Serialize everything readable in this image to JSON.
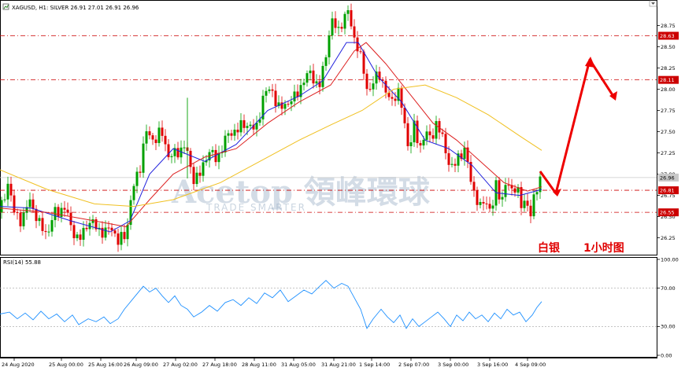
{
  "header": {
    "symbol_line": "XAGUSD, H1:  SILVER  26.91 27.01 26.91 26.96",
    "rsi_label": "RSI(14) 55.88"
  },
  "watermark": {
    "brand": "Acetop 領峰環球",
    "tagline": "TRADE SMARTER"
  },
  "annotation": {
    "asset": "白银",
    "timeframe": "1小时图"
  },
  "colors": {
    "bull": "#00a000",
    "bear": "#e00000",
    "ma_fast": "#2222dd",
    "ma_mid": "#dd2222",
    "ma_slow": "#f0c020",
    "level_line": "#cc0000",
    "rsi_line": "#1e90ff",
    "arrow": "#ee0000"
  },
  "chart_data": [
    {
      "type": "line",
      "title": "XAGUSD, H1:  SILVER  26.91 27.01 26.91 26.96",
      "x_tick_labels": [
        "24 Aug 2020",
        "25 Aug 00:00",
        "25 Aug 16:00",
        "26 Aug 09:00",
        "27 Aug 02:00",
        "27 Aug 18:00",
        "28 Aug 11:00",
        "31 Aug 05:00",
        "31 Aug 21:00",
        "1 Sep 14:00",
        "2 Sep 07:00",
        "3 Sep 00:00",
        "3 Sep 16:00",
        "4 Sep 09:00"
      ],
      "y_tick_labels": [
        "26.25",
        "26.50",
        "26.75",
        "27.00",
        "27.25",
        "27.50",
        "27.75",
        "28.00",
        "28.25",
        "28.50",
        "28.75"
      ],
      "ylim": [
        26.07,
        28.94
      ],
      "price_points": [
        [
          0,
          26.55
        ],
        [
          10,
          26.9
        ],
        [
          18,
          26.55
        ],
        [
          28,
          26.45
        ],
        [
          38,
          26.7
        ],
        [
          50,
          26.4
        ],
        [
          60,
          26.3
        ],
        [
          70,
          26.55
        ],
        [
          82,
          26.6
        ],
        [
          92,
          26.35
        ],
        [
          100,
          26.2
        ],
        [
          112,
          26.45
        ],
        [
          122,
          26.38
        ],
        [
          132,
          26.3
        ],
        [
          142,
          26.38
        ],
        [
          150,
          26.2
        ],
        [
          160,
          26.3
        ],
        [
          168,
          26.8
        ],
        [
          178,
          27.1
        ],
        [
          185,
          27.5
        ],
        [
          195,
          27.4
        ],
        [
          205,
          27.5
        ],
        [
          215,
          27.2
        ],
        [
          225,
          27.25
        ],
        [
          235,
          27.35
        ],
        [
          245,
          26.95
        ],
        [
          255,
          27.0
        ],
        [
          265,
          27.3
        ],
        [
          275,
          27.15
        ],
        [
          285,
          27.4
        ],
        [
          295,
          27.5
        ],
        [
          305,
          27.55
        ],
        [
          315,
          27.6
        ],
        [
          325,
          27.5
        ],
        [
          335,
          27.95
        ],
        [
          345,
          28.0
        ],
        [
          355,
          27.75
        ],
        [
          365,
          27.85
        ],
        [
          375,
          27.9
        ],
        [
          385,
          28.1
        ],
        [
          395,
          28.2
        ],
        [
          405,
          28.0
        ],
        [
          413,
          28.35
        ],
        [
          420,
          28.8
        ],
        [
          430,
          28.7
        ],
        [
          437,
          28.85
        ],
        [
          443,
          28.9
        ],
        [
          450,
          28.6
        ],
        [
          456,
          28.45
        ],
        [
          462,
          28.2
        ],
        [
          468,
          27.95
        ],
        [
          475,
          28.1
        ],
        [
          483,
          28.2
        ],
        [
          490,
          27.95
        ],
        [
          497,
          27.85
        ],
        [
          505,
          28.0
        ],
        [
          512,
          27.7
        ],
        [
          519,
          27.3
        ],
        [
          526,
          27.55
        ],
        [
          533,
          27.3
        ],
        [
          540,
          27.5
        ],
        [
          547,
          27.4
        ],
        [
          554,
          27.6
        ],
        [
          561,
          27.45
        ],
        [
          568,
          27.2
        ],
        [
          575,
          27.05
        ],
        [
          582,
          27.2
        ],
        [
          590,
          27.3
        ],
        [
          596,
          27.0
        ],
        [
          602,
          26.8
        ],
        [
          610,
          26.6
        ],
        [
          617,
          26.7
        ],
        [
          624,
          26.55
        ],
        [
          630,
          26.85
        ],
        [
          637,
          26.7
        ],
        [
          643,
          26.9
        ],
        [
          650,
          26.8
        ],
        [
          656,
          26.9
        ],
        [
          662,
          26.6
        ],
        [
          668,
          26.7
        ],
        [
          674,
          26.55
        ],
        [
          680,
          26.75
        ],
        [
          686,
          26.96
        ]
      ],
      "series": [
        {
          "values": [
            [
              0,
              26.62
            ],
            [
              40,
              26.6
            ],
            [
              90,
              26.45
            ],
            [
              140,
              26.32
            ],
            [
              165,
              26.45
            ],
            [
              190,
              27.0
            ],
            [
              220,
              27.3
            ],
            [
              260,
              27.15
            ],
            [
              300,
              27.35
            ],
            [
              340,
              27.75
            ],
            [
              380,
              27.92
            ],
            [
              410,
              28.1
            ],
            [
              440,
              28.55
            ],
            [
              455,
              28.55
            ],
            [
              480,
              28.15
            ],
            [
              510,
              27.85
            ],
            [
              540,
              27.4
            ],
            [
              570,
              27.3
            ],
            [
              600,
              27.1
            ],
            [
              630,
              26.78
            ],
            [
              660,
              26.75
            ],
            [
              688,
              26.82
            ]
          ]
        },
        {
          "values": [
            [
              0,
              26.6
            ],
            [
              60,
              26.55
            ],
            [
              120,
              26.45
            ],
            [
              160,
              26.38
            ],
            [
              190,
              26.7
            ],
            [
              220,
              27.0
            ],
            [
              260,
              27.2
            ],
            [
              300,
              27.3
            ],
            [
              340,
              27.6
            ],
            [
              380,
              27.85
            ],
            [
              420,
              28.05
            ],
            [
              450,
              28.45
            ],
            [
              465,
              28.55
            ],
            [
              490,
              28.3
            ],
            [
              520,
              27.95
            ],
            [
              550,
              27.6
            ],
            [
              580,
              27.4
            ],
            [
              610,
              27.15
            ],
            [
              640,
              26.9
            ],
            [
              670,
              26.8
            ],
            [
              688,
              26.85
            ]
          ]
        },
        {
          "values": [
            [
              0,
              27.05
            ],
            [
              60,
              26.82
            ],
            [
              120,
              26.65
            ],
            [
              170,
              26.62
            ],
            [
              220,
              26.7
            ],
            [
              280,
              26.9
            ],
            [
              340,
              27.2
            ],
            [
              380,
              27.4
            ],
            [
              420,
              27.58
            ],
            [
              460,
              27.75
            ],
            [
              500,
              28.0
            ],
            [
              540,
              28.05
            ],
            [
              580,
              27.9
            ],
            [
              620,
              27.7
            ],
            [
              660,
              27.45
            ],
            [
              688,
              27.28
            ]
          ]
        }
      ],
      "horizontal_levels": [
        {
          "label": "28.63",
          "value": 28.63
        },
        {
          "label": "28.11",
          "value": 28.11
        },
        {
          "label": "26.81",
          "value": 26.81
        },
        {
          "label": "26.55",
          "value": 26.55
        }
      ],
      "current_price_label": "26.96",
      "current_price": 26.96
    },
    {
      "type": "line",
      "title": "RSI(14) 55.88",
      "y_tick_labels": [
        "0.00",
        "30.00",
        "70.00",
        "100.00"
      ],
      "ylim": [
        0,
        100
      ],
      "levels": [
        30,
        70
      ],
      "values": [
        [
          0,
          43
        ],
        [
          12,
          45
        ],
        [
          22,
          38
        ],
        [
          32,
          44
        ],
        [
          42,
          37
        ],
        [
          52,
          46
        ],
        [
          62,
          38
        ],
        [
          72,
          43
        ],
        [
          82,
          35
        ],
        [
          92,
          42
        ],
        [
          100,
          32
        ],
        [
          112,
          38
        ],
        [
          122,
          35
        ],
        [
          132,
          40
        ],
        [
          140,
          33
        ],
        [
          150,
          38
        ],
        [
          158,
          48
        ],
        [
          168,
          58
        ],
        [
          175,
          65
        ],
        [
          182,
          72
        ],
        [
          190,
          66
        ],
        [
          198,
          70
        ],
        [
          206,
          62
        ],
        [
          214,
          55
        ],
        [
          222,
          62
        ],
        [
          230,
          52
        ],
        [
          238,
          48
        ],
        [
          246,
          40
        ],
        [
          256,
          45
        ],
        [
          266,
          52
        ],
        [
          276,
          46
        ],
        [
          286,
          55
        ],
        [
          296,
          58
        ],
        [
          306,
          52
        ],
        [
          316,
          60
        ],
        [
          326,
          54
        ],
        [
          336,
          65
        ],
        [
          346,
          60
        ],
        [
          356,
          68
        ],
        [
          366,
          56
        ],
        [
          376,
          62
        ],
        [
          386,
          68
        ],
        [
          396,
          64
        ],
        [
          406,
          72
        ],
        [
          414,
          78
        ],
        [
          424,
          70
        ],
        [
          434,
          75
        ],
        [
          442,
          72
        ],
        [
          450,
          60
        ],
        [
          458,
          48
        ],
        [
          466,
          28
        ],
        [
          474,
          38
        ],
        [
          484,
          48
        ],
        [
          492,
          40
        ],
        [
          500,
          34
        ],
        [
          508,
          42
        ],
        [
          516,
          28
        ],
        [
          524,
          38
        ],
        [
          532,
          30
        ],
        [
          540,
          35
        ],
        [
          548,
          40
        ],
        [
          556,
          45
        ],
        [
          564,
          38
        ],
        [
          572,
          30
        ],
        [
          580,
          42
        ],
        [
          588,
          36
        ],
        [
          596,
          45
        ],
        [
          604,
          38
        ],
        [
          612,
          42
        ],
        [
          620,
          35
        ],
        [
          628,
          44
        ],
        [
          636,
          38
        ],
        [
          644,
          48
        ],
        [
          652,
          42
        ],
        [
          660,
          45
        ],
        [
          668,
          35
        ],
        [
          676,
          42
        ],
        [
          682,
          50
        ],
        [
          688,
          56
        ]
      ]
    }
  ]
}
